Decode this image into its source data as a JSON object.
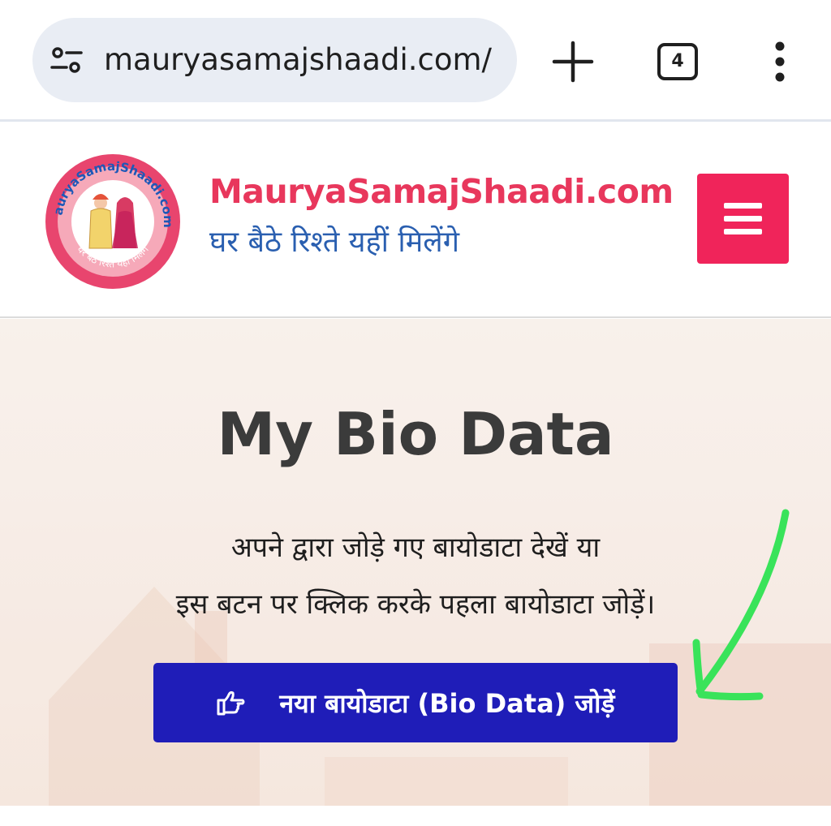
{
  "browser": {
    "url": "mauryasamajshaadi.com/",
    "tab_count": "4",
    "site_info_icon": "tune-icon",
    "new_tab_icon": "plus-icon",
    "menu_icon": "more-vert-icon"
  },
  "header": {
    "title": "MauryaSamajShaadi.com",
    "tagline": "घर बैठे रिश्ते यहीं मिलेंगे",
    "logo_ring_text": "MauryaSamajShaadi.com",
    "logo_bottom_text": "घर बैठे रिश्ते यहीं मिलेंगे",
    "menu_button_icon": "hamburger-icon"
  },
  "hero": {
    "title": "My Bio Data",
    "line1": "अपने द्वारा जोड़े गए बायोडाटा देखें या",
    "line2": "इस बटन पर क्लिक करके पहला बायोडाटा जोड़ें।",
    "cta_label": "नया बायोडाटा (Bio Data) जोड़ें",
    "cta_icon": "hand-pointer-icon"
  },
  "colors": {
    "brand_pink": "#e8375c",
    "tagline_blue": "#2a5fb0",
    "menu_button": "#f0245a",
    "cta_blue": "#1f1db8",
    "annotation_green": "#39e35a"
  }
}
